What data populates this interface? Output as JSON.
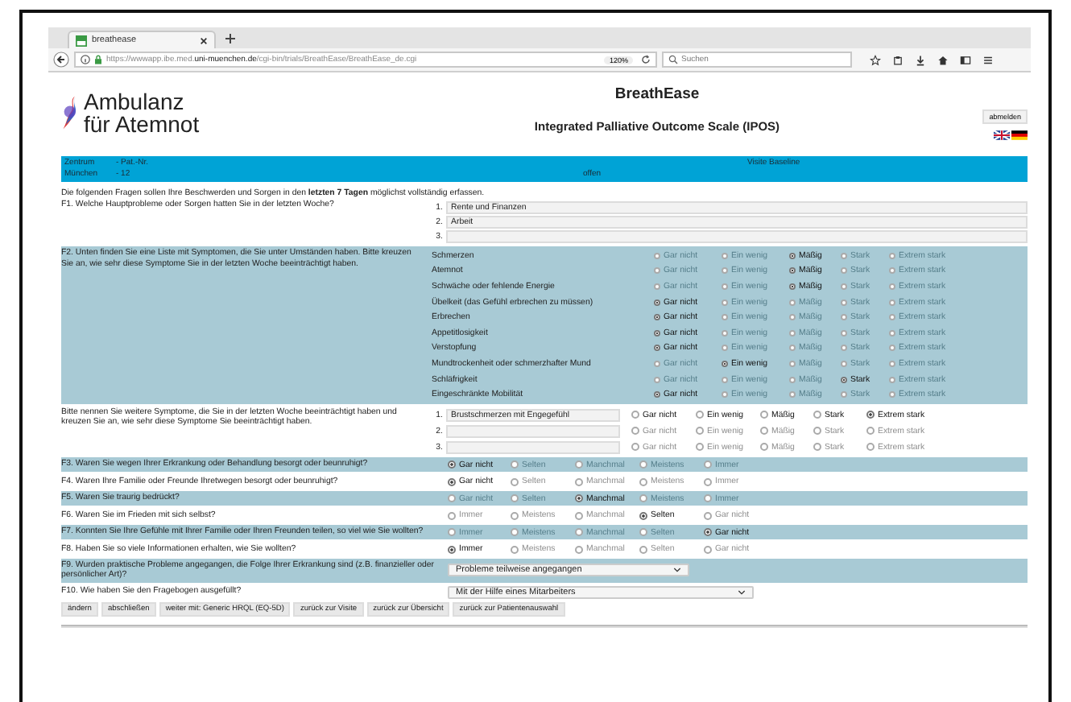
{
  "browser": {
    "tab_title": "breathease",
    "url_prefix": "https://wwwapp.ibe.med.",
    "url_domain": "uni-muenchen.de",
    "url_path": "/cgi-bin/trials/BreathEase/BreathEase_de.cgi",
    "zoom": "120%",
    "search_placeholder": "Suchen"
  },
  "header": {
    "logo_lines": [
      "Ambulanz",
      "für Atemnot"
    ],
    "title": "BreathEase",
    "subtitle": "Integrated Palliative Outcome Scale (IPOS)",
    "logout": "abmelden"
  },
  "info_bar": [
    {
      "top": "Zentrum",
      "bottom": "München"
    },
    {
      "top": "- Pat.-Nr.",
      "bottom": "- 12"
    },
    {
      "bottom": "offen"
    },
    {
      "top": "Visite Baseline"
    }
  ],
  "intro": "Die folgenden Fragen sollen Ihre Beschwerden und Sorgen in den **letzten 7 Tagen** möglichst vollständig erfassen.",
  "f1": {
    "question": "F1. Welche Hauptprobleme oder Sorgen hatten Sie in der letzten Woche?",
    "answers": [
      {
        "number": "1.",
        "value": "Rente und Finanzen"
      },
      {
        "number": "2.",
        "value": "Arbeit"
      },
      {
        "number": "3."
      }
    ]
  },
  "f2": {
    "question": "F2. Unten finden Sie eine Liste mit Symptomen, die Sie unter Umständen haben. Bitte kreuzen Sie an, wie sehr diese Symptome Sie in der letzten Woche beeinträchtigt haben.",
    "symptoms": [
      {
        "name": "Schmerzen",
        "dimmed": true,
        "options": [
          {
            "label": "Gar nicht",
            "selected": false
          },
          {
            "label": "Ein wenig",
            "selected": false
          },
          {
            "label": "Mäßig",
            "selected": true
          },
          {
            "label": "Stark",
            "selected": false
          },
          {
            "label": "Extrem stark",
            "selected": false
          }
        ]
      },
      {
        "name": "Atemnot",
        "dimmed": true,
        "options": [
          {
            "label": "Gar nicht",
            "selected": false
          },
          {
            "label": "Ein wenig",
            "selected": false
          },
          {
            "label": "Mäßig",
            "selected": true
          },
          {
            "label": "Stark",
            "selected": false
          },
          {
            "label": "Extrem stark",
            "selected": false
          }
        ]
      },
      {
        "name": "Schwäche oder fehlende Energie",
        "dimmed": true,
        "options": [
          {
            "label": "Gar nicht",
            "selected": false
          },
          {
            "label": "Ein wenig",
            "selected": false
          },
          {
            "label": "Mäßig",
            "selected": true
          },
          {
            "label": "Stark",
            "selected": false
          },
          {
            "label": "Extrem stark",
            "selected": false
          }
        ]
      },
      {
        "name": "Übelkeit (das Gefühl erbrechen zu müssen)",
        "dimmed": true,
        "options": [
          {
            "label": "Gar nicht",
            "selected": true
          },
          {
            "label": "Ein wenig",
            "selected": false
          },
          {
            "label": "Mäßig",
            "selected": false
          },
          {
            "label": "Stark",
            "selected": false
          },
          {
            "label": "Extrem stark",
            "selected": false
          }
        ]
      },
      {
        "name": "Erbrechen",
        "dimmed": true,
        "options": [
          {
            "label": "Gar nicht",
            "selected": true
          },
          {
            "label": "Ein wenig",
            "selected": false
          },
          {
            "label": "Mäßig",
            "selected": false
          },
          {
            "label": "Stark",
            "selected": false
          },
          {
            "label": "Extrem stark",
            "selected": false
          }
        ]
      },
      {
        "name": "Appetitlosigkeit",
        "dimmed": true,
        "options": [
          {
            "label": "Gar nicht",
            "selected": true
          },
          {
            "label": "Ein wenig",
            "selected": false
          },
          {
            "label": "Mäßig",
            "selected": false
          },
          {
            "label": "Stark",
            "selected": false
          },
          {
            "label": "Extrem stark",
            "selected": false
          }
        ]
      },
      {
        "name": "Verstopfung",
        "dimmed": true,
        "options": [
          {
            "label": "Gar nicht",
            "selected": true
          },
          {
            "label": "Ein wenig",
            "selected": false
          },
          {
            "label": "Mäßig",
            "selected": false
          },
          {
            "label": "Stark",
            "selected": false
          },
          {
            "label": "Extrem stark",
            "selected": false
          }
        ]
      },
      {
        "name": "Mundtrockenheit oder schmerzhafter Mund",
        "dimmed": true,
        "options": [
          {
            "label": "Gar nicht",
            "selected": false
          },
          {
            "label": "Ein wenig",
            "selected": true
          },
          {
            "label": "Mäßig",
            "selected": false
          },
          {
            "label": "Stark",
            "selected": false
          },
          {
            "label": "Extrem stark",
            "selected": false
          }
        ]
      },
      {
        "name": "Schläfrigkeit",
        "dimmed": true,
        "options": [
          {
            "label": "Gar nicht",
            "selected": false
          },
          {
            "label": "Ein wenig",
            "selected": false
          },
          {
            "label": "Mäßig",
            "selected": false
          },
          {
            "label": "Stark",
            "selected": true
          },
          {
            "label": "Extrem stark",
            "selected": false
          }
        ]
      },
      {
        "name": "Eingeschränkte Mobilität",
        "dimmed": true,
        "options": [
          {
            "label": "Gar nicht",
            "selected": true
          },
          {
            "label": "Ein wenig",
            "selected": false
          },
          {
            "label": "Mäßig",
            "selected": false
          },
          {
            "label": "Stark",
            "selected": false
          },
          {
            "label": "Extrem stark",
            "selected": false
          }
        ]
      }
    ]
  },
  "other_symptoms": {
    "question": "Bitte nennen Sie weitere Symptome, die Sie in der letzten Woche beeinträchtigt haben und kreuzen Sie an, wie sehr diese Symptome Sie beeinträchtigt haben.",
    "rows": [
      {
        "number": "1.",
        "value": "Brustschmerzen mit Engegefühl",
        "dimmed": false,
        "options": [
          {
            "label": "Gar nicht",
            "selected": false
          },
          {
            "label": "Ein wenig",
            "selected": false
          },
          {
            "label": "Mäßig",
            "selected": false
          },
          {
            "label": "Stark",
            "selected": false
          },
          {
            "label": "Extrem stark",
            "selected": true
          }
        ]
      },
      {
        "number": "2.",
        "dimmed": true,
        "options": [
          {
            "label": "Gar nicht",
            "selected": false
          },
          {
            "label": "Ein wenig",
            "selected": false
          },
          {
            "label": "Mäßig",
            "selected": false
          },
          {
            "label": "Stark",
            "selected": false
          },
          {
            "label": "Extrem stark",
            "selected": false
          }
        ]
      },
      {
        "number": "3.",
        "dimmed": true,
        "options": [
          {
            "label": "Gar nicht",
            "selected": false
          },
          {
            "label": "Ein wenig",
            "selected": false
          },
          {
            "label": "Mäßig",
            "selected": false
          },
          {
            "label": "Stark",
            "selected": false
          },
          {
            "label": "Extrem stark",
            "selected": false
          }
        ]
      }
    ]
  },
  "questions": [
    {
      "kind": "radio",
      "question": "F3. Waren Sie wegen Ihrer Erkrankung oder Behandlung besorgt oder beunruhigt?",
      "dimmed": true,
      "options": [
        {
          "label": "Gar nicht",
          "selected": true
        },
        {
          "label": "Selten",
          "selected": false
        },
        {
          "label": "Manchmal",
          "selected": false
        },
        {
          "label": "Meistens",
          "selected": false
        },
        {
          "label": "Immer",
          "selected": false
        }
      ]
    },
    {
      "kind": "radio",
      "question": "F4. Waren Ihre Familie oder Freunde Ihretwegen besorgt oder beunruhigt?",
      "dimmed": true,
      "options": [
        {
          "label": "Gar nicht",
          "selected": true
        },
        {
          "label": "Selten",
          "selected": false
        },
        {
          "label": "Manchmal",
          "selected": false
        },
        {
          "label": "Meistens",
          "selected": false
        },
        {
          "label": "Immer",
          "selected": false
        }
      ]
    },
    {
      "kind": "radio",
      "question": "F5. Waren Sie traurig bedrückt?",
      "dimmed": true,
      "options": [
        {
          "label": "Gar nicht",
          "selected": false
        },
        {
          "label": "Selten",
          "selected": false
        },
        {
          "label": "Manchmal",
          "selected": true
        },
        {
          "label": "Meistens",
          "selected": false
        },
        {
          "label": "Immer",
          "selected": false
        }
      ]
    },
    {
      "kind": "radio",
      "question": "F6. Waren Sie im Frieden mit sich selbst?",
      "dimmed": true,
      "options": [
        {
          "label": "Immer",
          "selected": false
        },
        {
          "label": "Meistens",
          "selected": false
        },
        {
          "label": "Manchmal",
          "selected": false
        },
        {
          "label": "Selten",
          "selected": true
        },
        {
          "label": "Gar nicht",
          "selected": false
        }
      ]
    },
    {
      "kind": "radio",
      "question": "F7. Konnten Sie Ihre Gefühle mit Ihrer Familie oder Ihren Freunden teilen, so viel wie Sie wollten?",
      "dimmed": true,
      "options": [
        {
          "label": "Immer",
          "selected": false
        },
        {
          "label": "Meistens",
          "selected": false
        },
        {
          "label": "Manchmal",
          "selected": false
        },
        {
          "label": "Selten",
          "selected": false
        },
        {
          "label": "Gar nicht",
          "selected": true
        }
      ]
    },
    {
      "kind": "radio",
      "question": "F8. Haben Sie so viele Informationen erhalten, wie Sie wollten?",
      "dimmed": true,
      "options": [
        {
          "label": "Immer",
          "selected": true
        },
        {
          "label": "Meistens",
          "selected": false
        },
        {
          "label": "Manchmal",
          "selected": false
        },
        {
          "label": "Selten",
          "selected": false
        },
        {
          "label": "Gar nicht",
          "selected": false
        }
      ]
    },
    {
      "kind": "select",
      "question": "F9. Wurden praktische Probleme angegangen, die Folge Ihrer Erkrankung sind (z.B. finanzieller oder persönlicher Art)?",
      "value": "Probleme teilweise angegangen"
    },
    {
      "kind": "select",
      "question": "F10. Wie haben Sie den Fragebogen ausgefüllt?",
      "value": "Mit der Hilfe eines Mitarbeiters"
    }
  ],
  "buttons": [
    "ändern",
    "abschließen",
    "weiter mit: Generic HRQL (EQ-5D)",
    "zurück zur Visite",
    "zurück zur Übersicht",
    "zurück zur Patientenauswahl"
  ]
}
